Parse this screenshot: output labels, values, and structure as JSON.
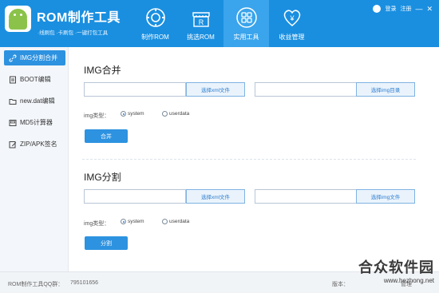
{
  "app": {
    "title": "ROM制作工具",
    "subtitle": "·线刷包 ·卡刷包 ·一键打包工具"
  },
  "nav": {
    "tabs": [
      {
        "label": "制作ROM",
        "icon": "gear-icon"
      },
      {
        "label": "挑选ROM",
        "icon": "shop-icon"
      },
      {
        "label": "实用工具",
        "icon": "grid-icon"
      },
      {
        "label": "收益管理",
        "icon": "yen-heart-icon"
      }
    ],
    "active_index": 2
  },
  "header_right": {
    "login": "登录",
    "register": "注册",
    "minimize": "—",
    "close": "✕"
  },
  "sidebar": {
    "items": [
      {
        "label": "IMG分割合并",
        "icon": "link-icon"
      },
      {
        "label": "BOOT编辑",
        "icon": "document-icon"
      },
      {
        "label": "new.dat编辑",
        "icon": "folder-icon"
      },
      {
        "label": "MD5计算器",
        "icon": "md5-icon"
      },
      {
        "label": "ZIP/APK签名",
        "icon": "edit-icon"
      }
    ],
    "active_index": 0
  },
  "merge": {
    "title": "IMG合并",
    "xml_input": "",
    "xml_button": "选择xml文件",
    "dir_input": "",
    "dir_button": "选择img目录",
    "type_label": "img类型：",
    "options": [
      "system",
      "userdata"
    ],
    "selected": "system",
    "action": "合并"
  },
  "split": {
    "title": "IMG分割",
    "xml_input": "",
    "xml_button": "选择xml文件",
    "img_input": "",
    "img_button": "选择img文件",
    "type_label": "img类型：",
    "options": [
      "system",
      "userdata"
    ],
    "selected": "system",
    "action": "分割"
  },
  "footer": {
    "qq_label": "ROM制作工具QQ群：",
    "qq_number": "795101656",
    "version_label": "版本：",
    "manage": "管理"
  },
  "watermark": {
    "text": "合众软件园",
    "url": "www.hezhong.net"
  },
  "colors": {
    "header": "#1a8fe0",
    "accent": "#2d92e0",
    "sidebar_bg": "#f3f6fa"
  }
}
